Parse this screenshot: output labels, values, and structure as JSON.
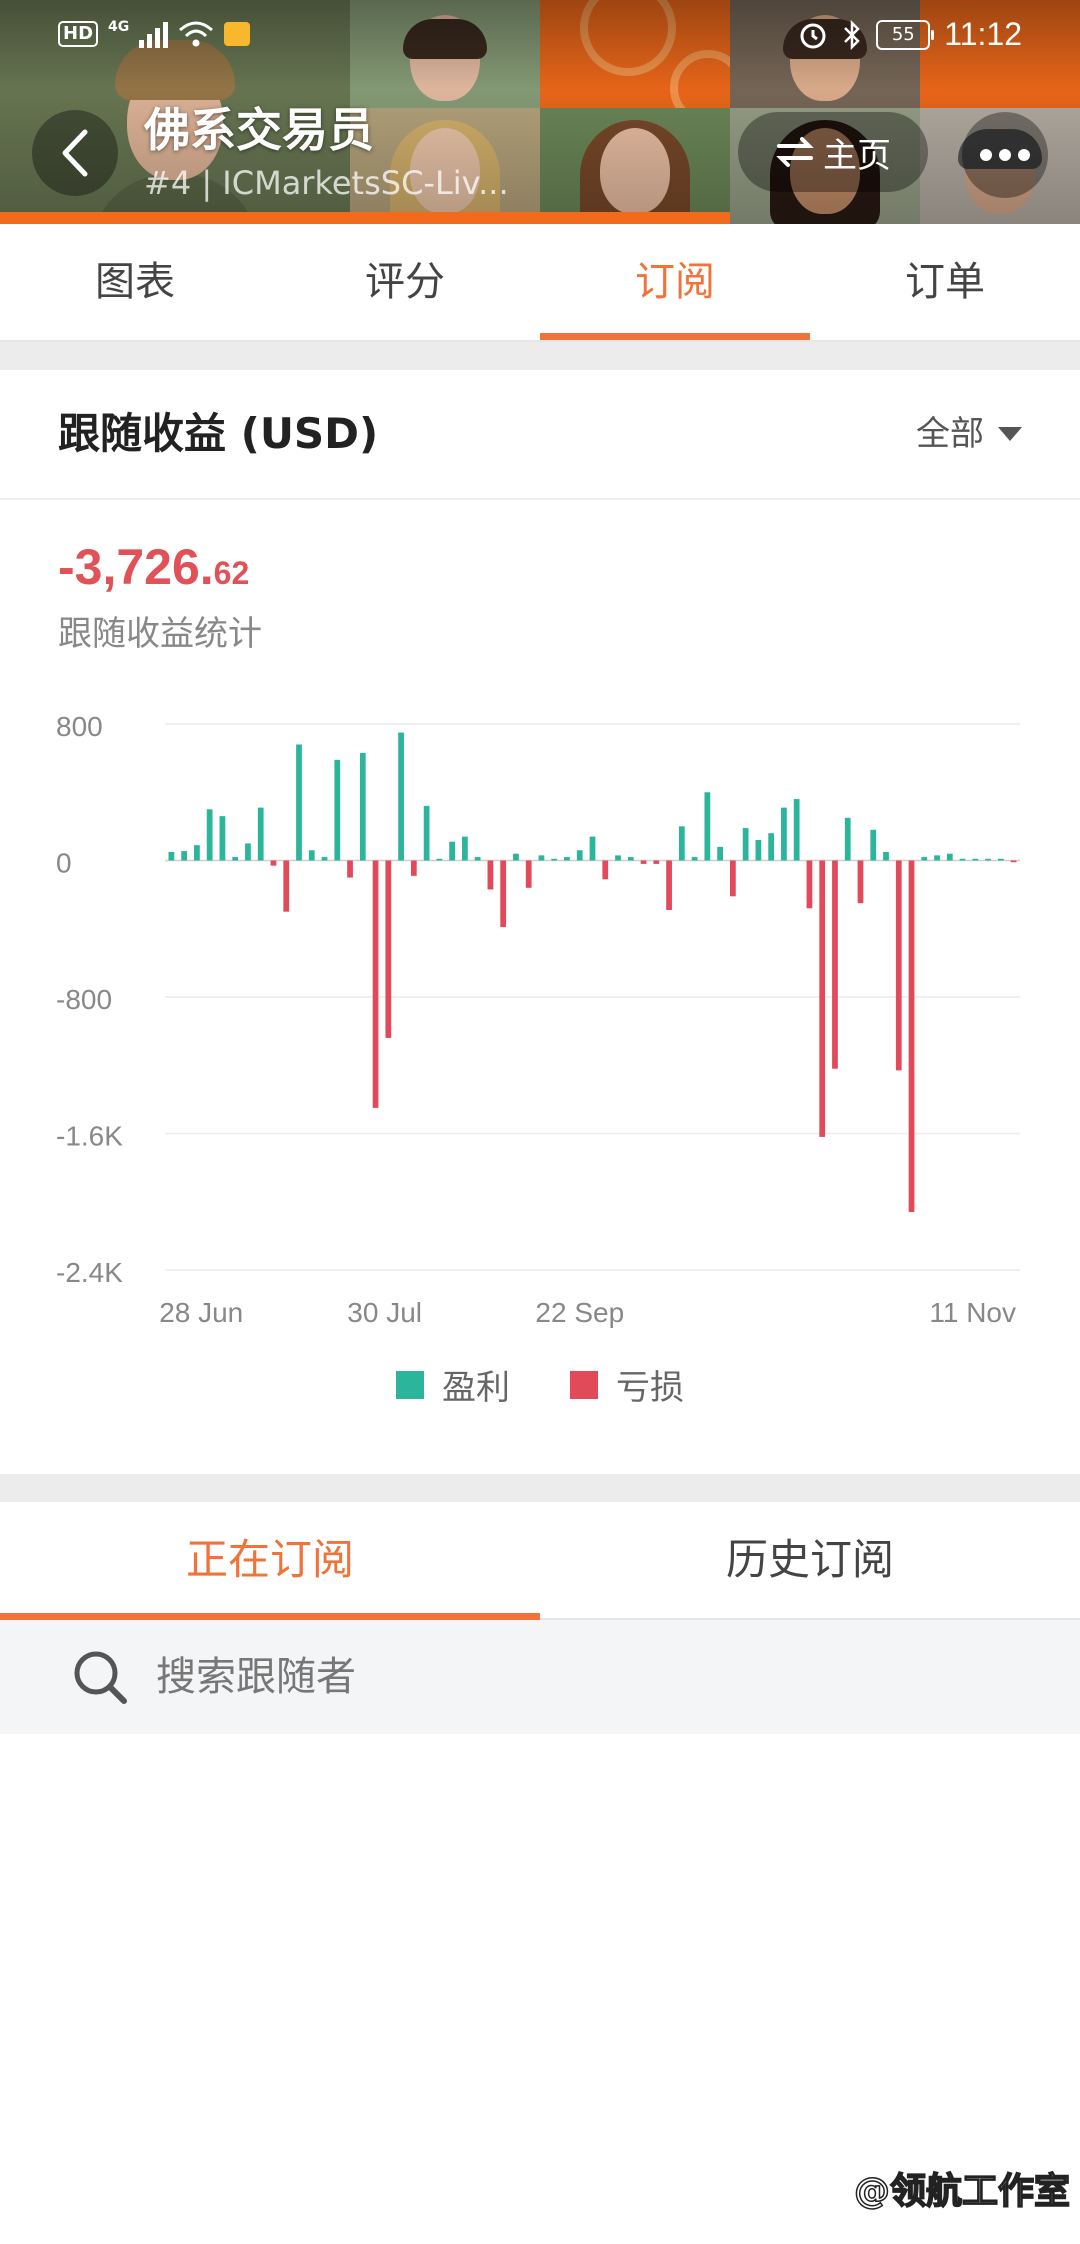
{
  "status_bar": {
    "hd": "HD",
    "network": "4G",
    "battery": "55",
    "time": "11:12"
  },
  "header": {
    "title": "佛系交易员",
    "subtitle": "#4 | ICMarketsSC-Liv...",
    "home_label": "主页"
  },
  "tabs": [
    {
      "label": "图表",
      "active": false
    },
    {
      "label": "评分",
      "active": false
    },
    {
      "label": "订阅",
      "active": true
    },
    {
      "label": "订单",
      "active": false
    }
  ],
  "earnings": {
    "title": "跟随收益 (USD)",
    "filter": "全部",
    "total_int": "-3,726.",
    "total_dec": "62",
    "total_label": "跟随收益统计"
  },
  "chart_data": {
    "type": "bar",
    "ylim": [
      -2400,
      800
    ],
    "y_ticks": [
      "800",
      "0",
      "-800",
      "-1.6K",
      "-2.4K"
    ],
    "x_ticks": [
      "28 Jun",
      "30 Jul",
      "22 Sep",
      "11 Nov"
    ],
    "series": [
      {
        "name": "盈利",
        "color": "#2bb59a"
      },
      {
        "name": "亏损",
        "color": "#e24a5a"
      }
    ],
    "values": [
      50,
      55,
      90,
      300,
      260,
      20,
      100,
      310,
      -30,
      -300,
      680,
      60,
      20,
      590,
      -100,
      630,
      -1450,
      -1040,
      750,
      -90,
      320,
      10,
      110,
      140,
      20,
      -170,
      -390,
      40,
      -160,
      30,
      10,
      20,
      60,
      140,
      -110,
      30,
      20,
      -20,
      -20,
      -290,
      200,
      20,
      400,
      80,
      -210,
      190,
      120,
      160,
      310,
      360,
      -280,
      -1620,
      -1220,
      250,
      -250,
      180,
      50,
      -1230,
      -2060,
      20,
      30,
      40,
      10,
      10,
      10,
      10,
      -10
    ]
  },
  "legend": {
    "profit": "盈利",
    "loss": "亏损"
  },
  "sub_tabs": [
    {
      "label": "正在订阅",
      "active": true
    },
    {
      "label": "历史订阅",
      "active": false
    }
  ],
  "search": {
    "placeholder": "搜索跟随者"
  },
  "watermark": "@领航工作室"
}
